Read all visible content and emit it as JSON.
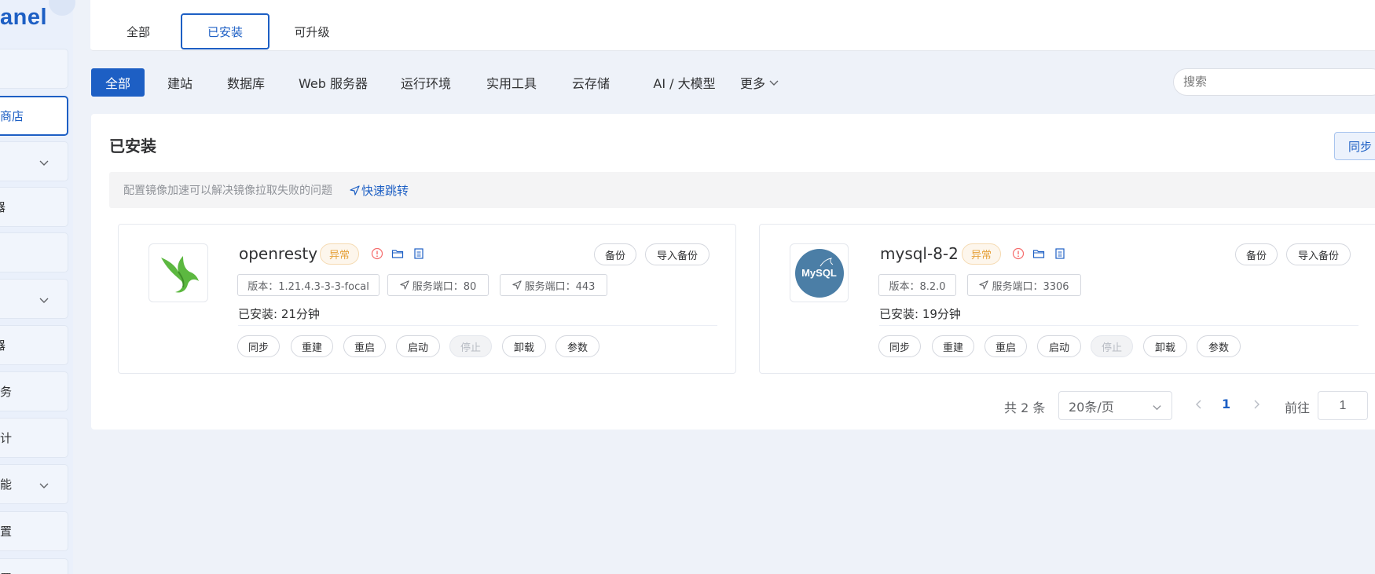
{
  "sidebar": {
    "logo_text": "anel",
    "items": [
      {
        "label": ""
      },
      {
        "label": "商店"
      },
      {
        "label": ""
      },
      {
        "label": "器"
      },
      {
        "label": ""
      },
      {
        "label": ""
      },
      {
        "label": "器"
      },
      {
        "label": "务"
      },
      {
        "label": "计"
      },
      {
        "label": "能"
      },
      {
        "label": "置"
      },
      {
        "label": "置"
      }
    ]
  },
  "tabs": [
    {
      "label": "全部"
    },
    {
      "label": "已安装"
    },
    {
      "label": "可升级"
    }
  ],
  "categories": [
    {
      "label": "全部"
    },
    {
      "label": "建站"
    },
    {
      "label": "数据库"
    },
    {
      "label": "Web 服务器"
    },
    {
      "label": "运行环境"
    },
    {
      "label": "实用工具"
    },
    {
      "label": "云存储"
    },
    {
      "label": "AI / 大模型"
    },
    {
      "label": "更多"
    }
  ],
  "search": {
    "placeholder": "搜索"
  },
  "panel": {
    "title": "已安装",
    "sync_label": "同步"
  },
  "notice": {
    "text": "配置镜像加速可以解决镜像拉取失败的问题",
    "link": "快速跳转"
  },
  "apps": [
    {
      "name": "openresty",
      "status": "异常",
      "backup_label": "备份",
      "import_backup_label": "导入备份",
      "version": "版本：1.21.4.3-3-3-focal",
      "ports": [
        "服务端口：80",
        "服务端口：443"
      ],
      "installed": "已安装:   21分钟",
      "actions": [
        "同步",
        "重建",
        "重启",
        "启动",
        "停止",
        "卸载",
        "参数"
      ]
    },
    {
      "name": "mysql-8-2",
      "status": "异常",
      "backup_label": "备份",
      "import_backup_label": "导入备份",
      "version": "版本：8.2.0",
      "ports": [
        "服务端口：3306"
      ],
      "installed": "已安装:   19分钟",
      "actions": [
        "同步",
        "重建",
        "重启",
        "启动",
        "停止",
        "卸载",
        "参数"
      ],
      "logo_text": "MySQL"
    }
  ],
  "pagination": {
    "total": "共 2 条",
    "page_size": "20条/页",
    "current_page": "1",
    "goto_label": "前往",
    "goto_value": "1"
  },
  "colors": {
    "accent": "#1d5fc4",
    "warning": "#e6a23c",
    "mysql_bg": "#4b7ea6"
  }
}
